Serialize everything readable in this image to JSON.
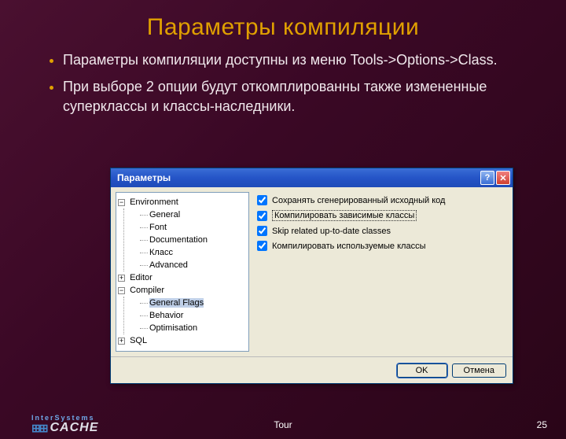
{
  "slide": {
    "title": "Параметры компиляции",
    "bullets": [
      "Параметры компиляции доступны из меню Tools->Options->Class.",
      "При выборе 2 опции будут откомплированны также измененные суперклассы и классы-наследники."
    ],
    "footer_label": "Tour",
    "page_number": "25"
  },
  "logo": {
    "company": "InterSystems",
    "product": "CACHE",
    "cube": "⊞⊞"
  },
  "dialog": {
    "title": "Параметры",
    "help_symbol": "?",
    "close_symbol": "✕",
    "tree": {
      "toggle_minus": "−",
      "toggle_plus": "+",
      "environment": "Environment",
      "environment_children": {
        "general": "General",
        "font": "Font",
        "documentation": "Documentation",
        "class": "Класс",
        "advanced": "Advanced"
      },
      "editor": "Editor",
      "compiler": "Compiler",
      "compiler_children": {
        "general_flags": "General Flags",
        "behavior": "Behavior",
        "optimisation": "Optimisation"
      },
      "sql": "SQL"
    },
    "checks": {
      "c0": "Сохранять сгенерированный исходный код",
      "c1": "Компилировать зависимые классы",
      "c2": "Skip related up-to-date classes",
      "c3": "Компилировать используемые классы"
    },
    "buttons": {
      "ok": "OK",
      "cancel": "Отмена"
    }
  }
}
